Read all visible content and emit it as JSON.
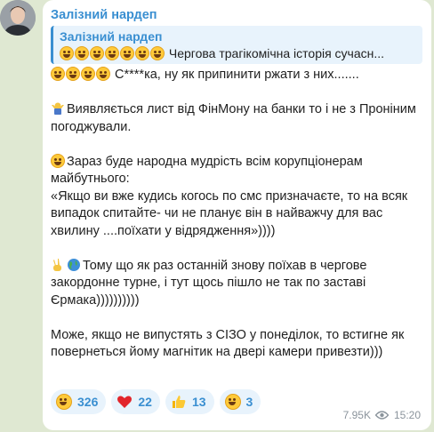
{
  "channel": {
    "avatar_icon": "person-avatar-icon",
    "sender": "Залізний нардеп"
  },
  "reply": {
    "author": "Залізний нардеп",
    "emoji_icons": [
      "rolling-laugh-icon",
      "rolling-laugh-icon",
      "rolling-laugh-icon",
      "exploding-head-icon",
      "exploding-head-icon",
      "exploding-head-icon",
      "exploding-head-icon"
    ],
    "text": "Чергова трагікомічна історія сучасн..."
  },
  "message": {
    "line1_emoji_icons": [
      "rolling-laugh-icon",
      "rolling-laugh-icon",
      "rolling-laugh-icon",
      "rolling-laugh-icon"
    ],
    "line1": "С****ка, ну як припинити ржати з них.......",
    "p2_icon": "person-shrugging-icon",
    "p2": "Виявляється лист від ФінМону на банки то і не з Проніним погоджували.",
    "p3_icon": "smiling-face-icon",
    "p3": "Зараз буде народна мудрість всім корупціонерам майбутнього:\n«Якщо ви вже кудись когось по смс призначаєте, то на всяк випадок спитайте- чи не планує він в найважчу для вас хвилину ....поїхати у відрядження»))))",
    "p4_icons": [
      "victory-hand-icon",
      "globe-icon"
    ],
    "p4": "Тому що як раз останній знову поїхав в чергове закордонне турне, і тут щось пішло не так по заставі Єрмака))))))))))",
    "p5": "Може, якщо не випустять з СІЗО у понеділок, то встигне як повернеться йому магнітик на двері камери привезти)))"
  },
  "reactions": [
    {
      "icon": "rolling-laugh-icon",
      "count": "326"
    },
    {
      "icon": "red-heart-icon",
      "count": "22"
    },
    {
      "icon": "thumbs-up-icon",
      "count": "13"
    },
    {
      "icon": "exploding-head-icon",
      "count": "3"
    }
  ],
  "meta": {
    "views": "7.95K",
    "views_icon": "eye-icon",
    "time": "15:20"
  }
}
